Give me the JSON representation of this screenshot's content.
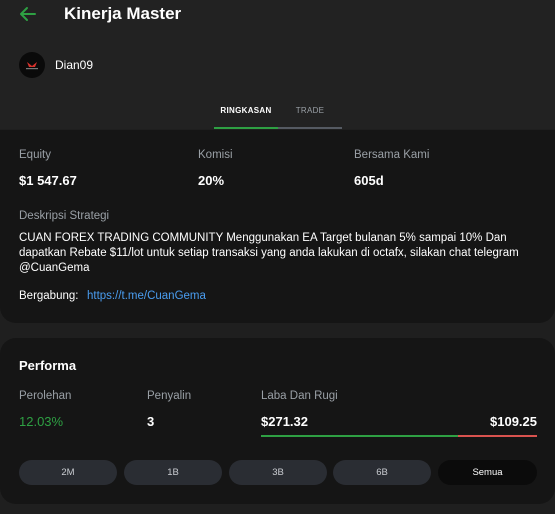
{
  "header": {
    "title": "Kinerja Master",
    "username": "Dian09",
    "tabs": [
      {
        "label": "RINGKASAN",
        "active": true
      },
      {
        "label": "TRADE",
        "active": false
      }
    ]
  },
  "summary": {
    "equity_label": "Equity",
    "equity_value": "$1 547.67",
    "commission_label": "Komisi",
    "commission_value": "20%",
    "tenure_label": "Bersama Kami",
    "tenure_value": "605d",
    "strategy_label": "Deskripsi Strategi",
    "strategy_text": "CUAN FOREX TRADING COMMUNITY Menggunakan EA Target bulanan 5% sampai 10% Dan dapatkan Rebate $11/lot untuk setiap transaksi yang anda lakukan di octafx, silakan chat telegram @CuanGema",
    "join_label": "Bergabung:",
    "join_link": "https://t.me/CuanGema"
  },
  "performance": {
    "title": "Performa",
    "gain_label": "Perolehan",
    "gain_value": "12.03%",
    "copiers_label": "Penyalin",
    "copiers_value": "3",
    "pnl_label": "Laba Dan Rugi",
    "profit_value": "$271.32",
    "loss_value": "$109.25",
    "periods": [
      {
        "label": "2M",
        "active": false
      },
      {
        "label": "1B",
        "active": false
      },
      {
        "label": "3B",
        "active": false
      },
      {
        "label": "6B",
        "active": false
      },
      {
        "label": "Semua",
        "active": true
      }
    ]
  },
  "colors": {
    "accent_green": "#2ea043",
    "loss_red": "#d9534f",
    "link_blue": "#4a9df0"
  },
  "icons": {
    "back": "arrow-left-icon",
    "avatar": "avatar-logo-icon"
  }
}
